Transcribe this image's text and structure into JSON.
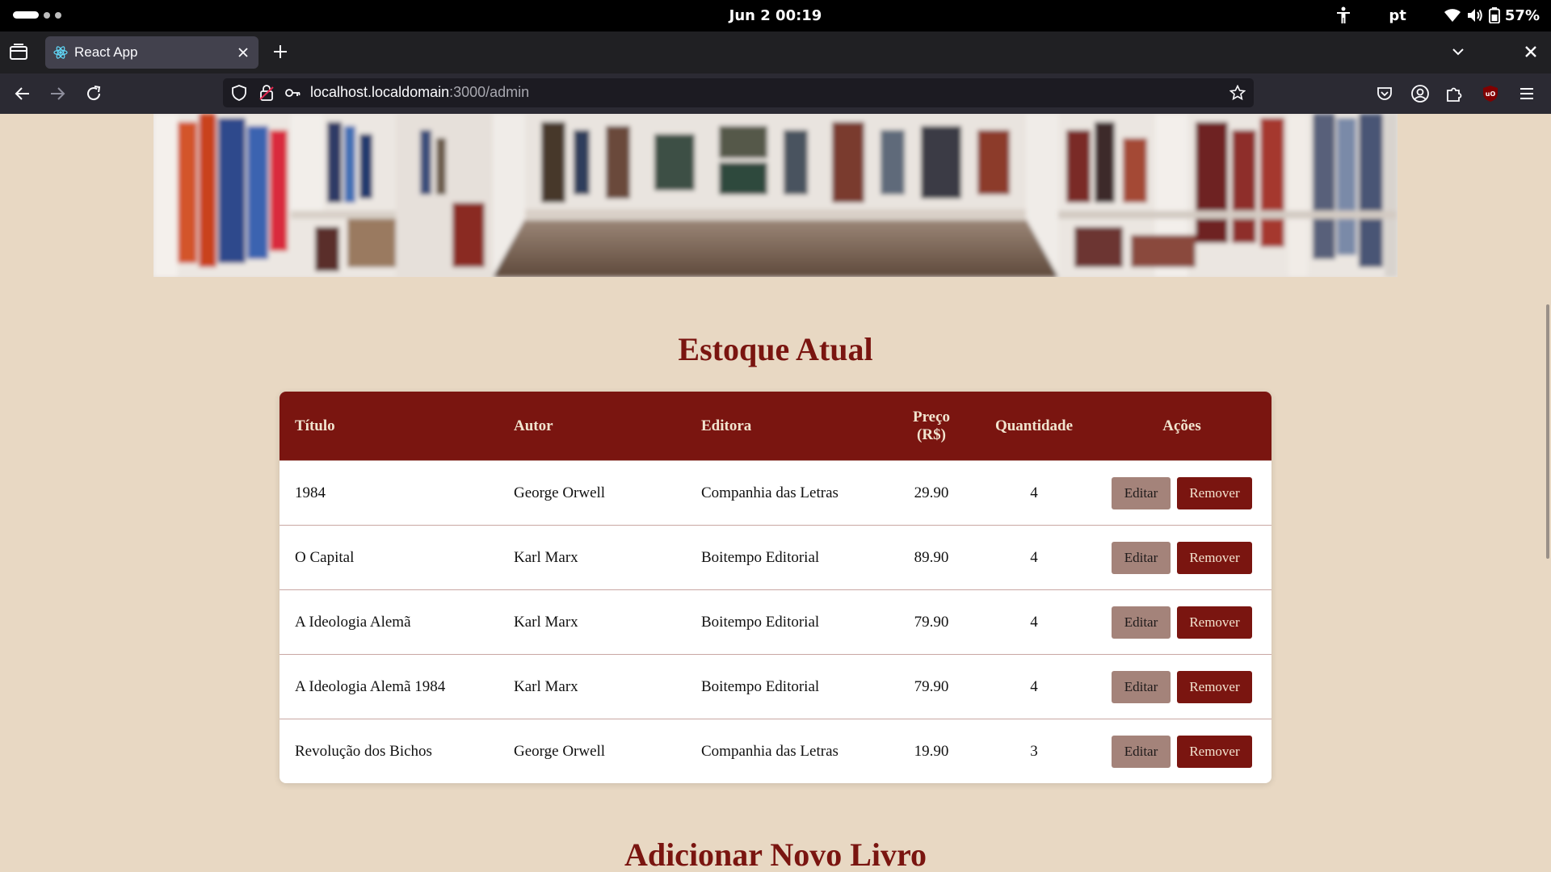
{
  "system_bar": {
    "clock": "Jun 2  00:19",
    "keyboard_layout": "pt",
    "battery_percent": "57%"
  },
  "browser": {
    "tab": {
      "title": "React App"
    },
    "url": {
      "host": "localhost.localdomain",
      "path": ":3000/admin"
    }
  },
  "page": {
    "stock_title": "Estoque Atual",
    "table": {
      "headers": {
        "title": "Título",
        "author": "Autor",
        "publisher": "Editora",
        "price_line1": "Preço",
        "price_line2": "(R$)",
        "quantity": "Quantidade",
        "actions": "Ações"
      },
      "rows": [
        {
          "title": "1984",
          "author": "George Orwell",
          "publisher": "Companhia das Letras",
          "price": "29.90",
          "quantity": "4"
        },
        {
          "title": "O Capital",
          "author": "Karl Marx",
          "publisher": "Boitempo Editorial",
          "price": "89.90",
          "quantity": "4"
        },
        {
          "title": "A Ideologia Alemã",
          "author": "Karl Marx",
          "publisher": "Boitempo Editorial",
          "price": "79.90",
          "quantity": "4"
        },
        {
          "title": "A Ideologia Alemã 1984",
          "author": "Karl Marx",
          "publisher": "Boitempo Editorial",
          "price": "79.90",
          "quantity": "4"
        },
        {
          "title": "Revolução dos Bichos",
          "author": "George Orwell",
          "publisher": "Companhia das Letras",
          "price": "19.90",
          "quantity": "3"
        }
      ],
      "edit_label": "Editar",
      "remove_label": "Remover"
    },
    "add_title": "Adicionar Novo Livro"
  },
  "colors": {
    "page_background": "#e8d8c3",
    "brand_maroon": "#7a1510",
    "edit_button": "#a4837a"
  }
}
